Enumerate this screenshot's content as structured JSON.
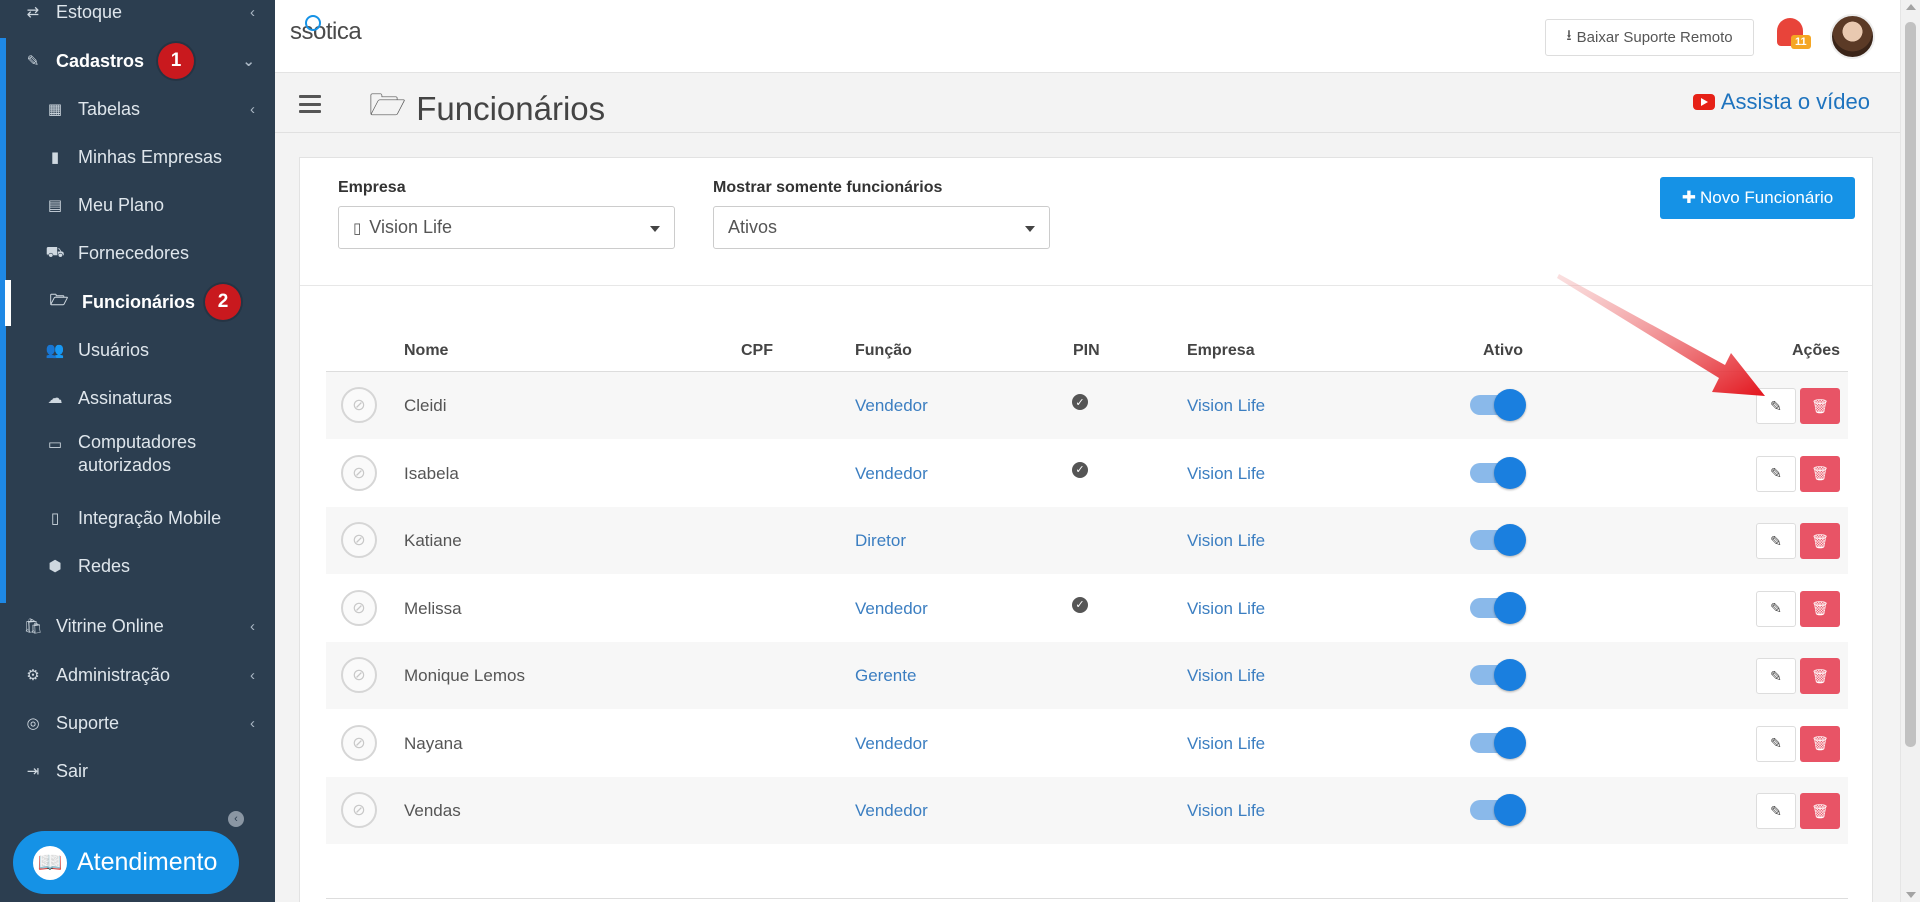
{
  "sidebar": {
    "estoque": "Estoque",
    "cadastros": "Cadastros",
    "cadastros_badge": "1",
    "items": [
      {
        "label": "Tabelas",
        "icon": "table-icon"
      },
      {
        "label": "Minhas Empresas",
        "icon": "building-icon"
      },
      {
        "label": "Meu Plano",
        "icon": "file-icon"
      },
      {
        "label": "Fornecedores",
        "icon": "truck-icon"
      },
      {
        "label": "Funcionários",
        "icon": "folder-open-icon"
      },
      {
        "label": "Usuários",
        "icon": "users-icon"
      },
      {
        "label": "Assinaturas",
        "icon": "cloud-icon"
      },
      {
        "label": "Computadores autorizados",
        "icon": "desktop-icon"
      },
      {
        "label": "Integração Mobile",
        "icon": "mobile-icon"
      },
      {
        "label": "Redes",
        "icon": "cubes-icon"
      }
    ],
    "funcionarios_badge": "2",
    "vitrine": "Vitrine Online",
    "administracao": "Administração",
    "suporte": "Suporte",
    "sair": "Sair",
    "atendimento": "Atendimento"
  },
  "topbar": {
    "logo": "ssotica",
    "suporte_button": "Baixar Suporte Remoto",
    "notification_count": "11"
  },
  "page": {
    "title": "Funcionários",
    "video_link": "Assista o vídeo"
  },
  "filters": {
    "empresa_label": "Empresa",
    "empresa_value": "Vision Life",
    "mostrar_label": "Mostrar somente funcionários",
    "mostrar_value": "Ativos",
    "novo_button": "Novo Funcionário"
  },
  "table": {
    "headers": [
      "Nome",
      "CPF",
      "Função",
      "PIN",
      "Empresa",
      "Ativo",
      "Ações"
    ],
    "rows": [
      {
        "nome": "Cleidi",
        "cpf": "",
        "funcao": "Vendedor",
        "pin": true,
        "empresa": "Vision Life",
        "ativo": true
      },
      {
        "nome": "Isabela",
        "cpf": "",
        "funcao": "Vendedor",
        "pin": true,
        "empresa": "Vision Life",
        "ativo": true
      },
      {
        "nome": "Katiane",
        "cpf": "",
        "funcao": "Diretor",
        "pin": false,
        "empresa": "Vision Life",
        "ativo": true
      },
      {
        "nome": "Melissa",
        "cpf": "",
        "funcao": "Vendedor",
        "pin": true,
        "empresa": "Vision Life",
        "ativo": true
      },
      {
        "nome": "Monique Lemos",
        "cpf": "",
        "funcao": "Gerente",
        "pin": false,
        "empresa": "Vision Life",
        "ativo": true
      },
      {
        "nome": "Nayana",
        "cpf": "",
        "funcao": "Vendedor",
        "pin": false,
        "empresa": "Vision Life",
        "ativo": true
      },
      {
        "nome": "Vendas",
        "cpf": "",
        "funcao": "Vendedor",
        "pin": false,
        "empresa": "Vision Life",
        "ativo": true
      }
    ]
  },
  "colors": {
    "sidebar_bg": "#2c3e50",
    "accent": "#1592e6",
    "danger": "#e85466",
    "badge": "#c9191e"
  }
}
